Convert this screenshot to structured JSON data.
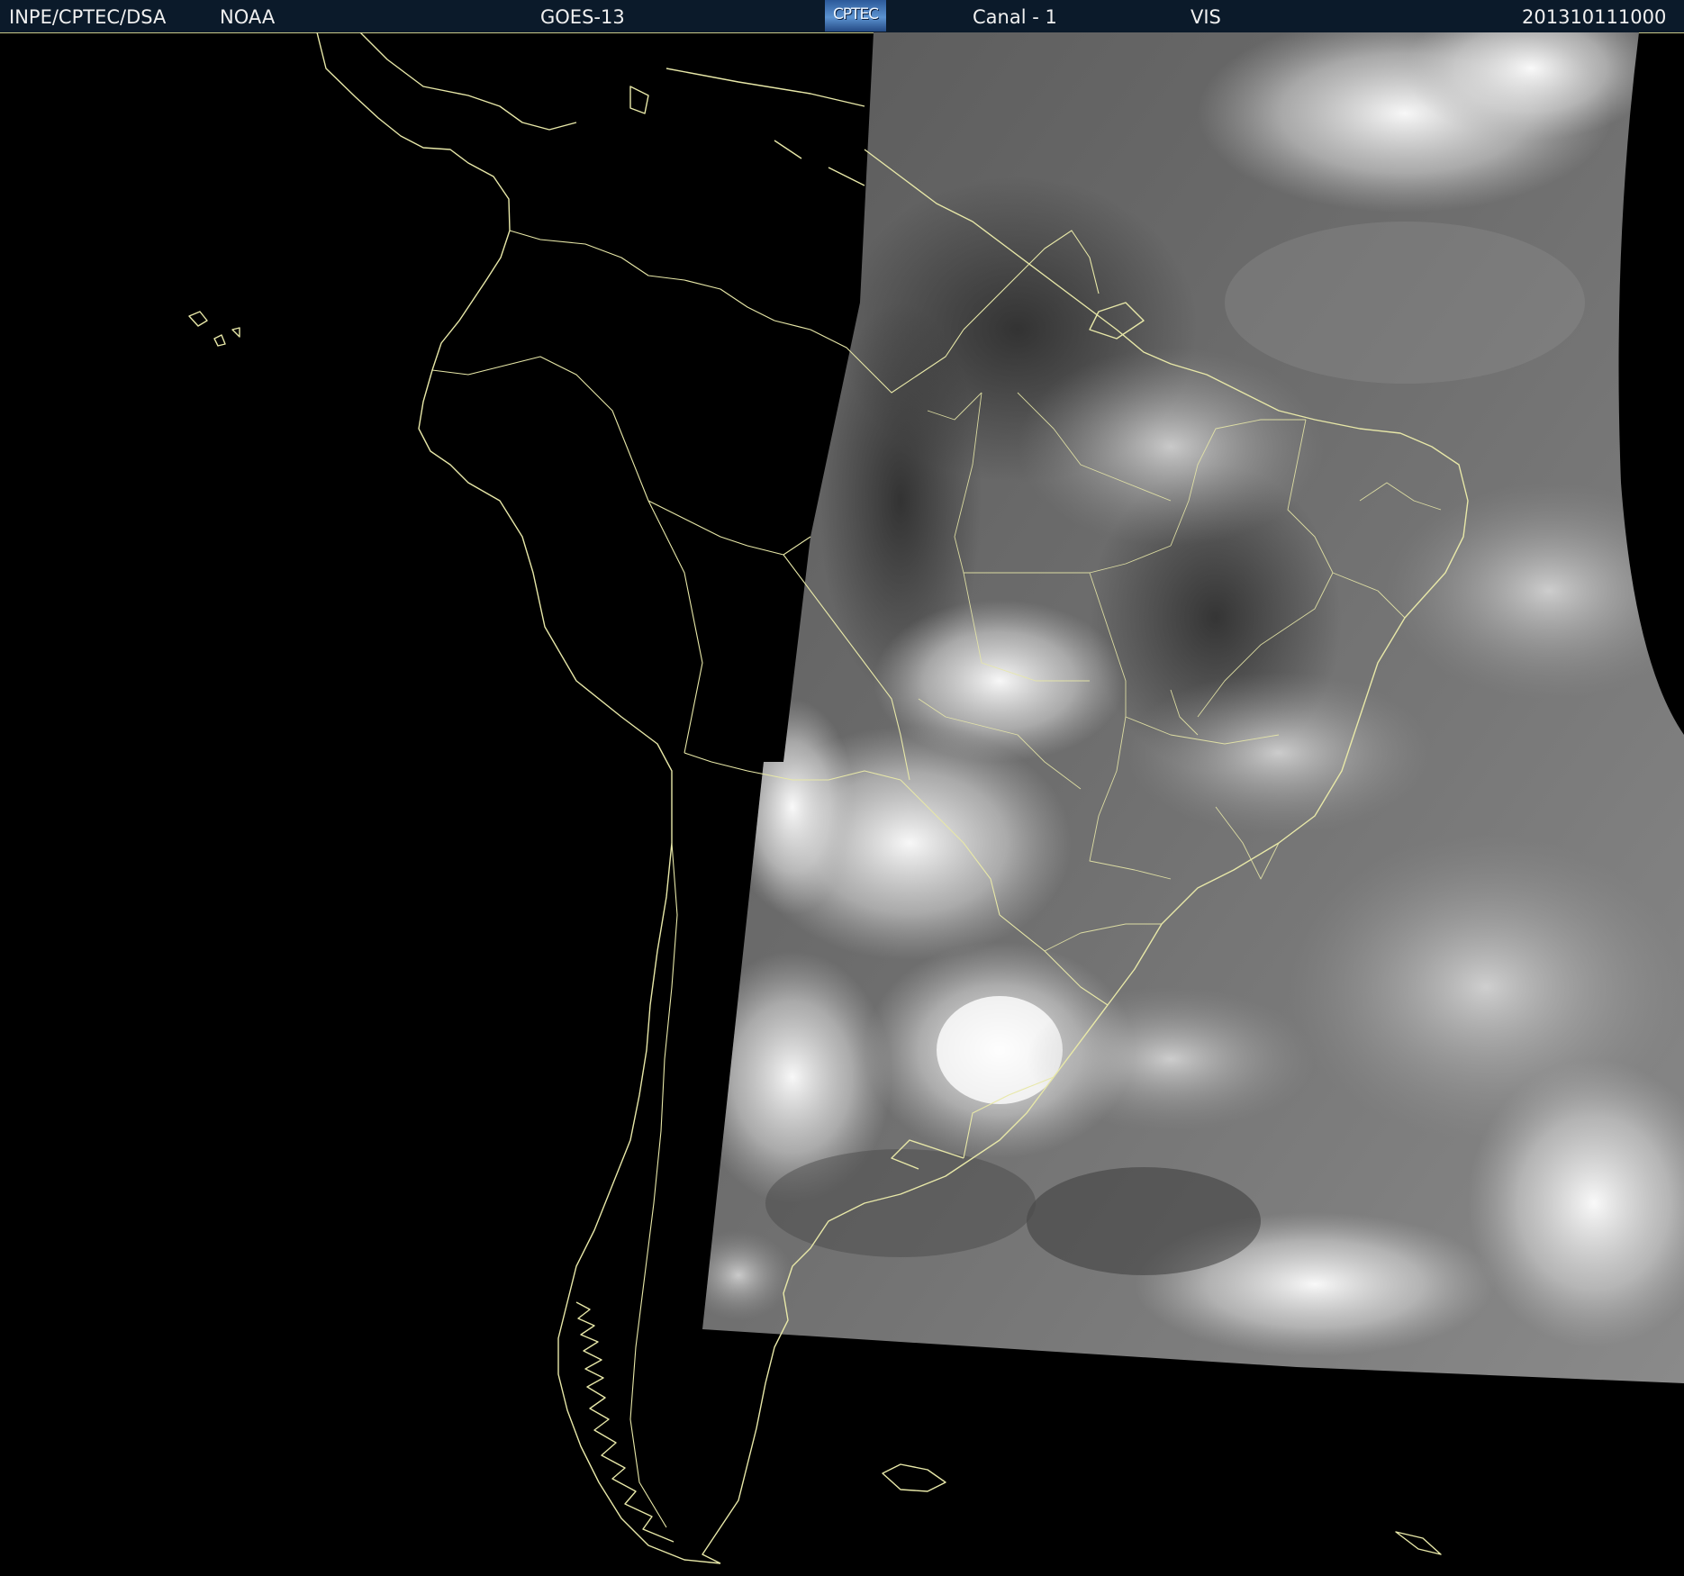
{
  "header": {
    "institution": "INPE/CPTEC/DSA",
    "agency": "NOAA",
    "satellite": "GOES-13",
    "logo_text": "CPTEC",
    "channel": "Canal - 1",
    "band": "VIS",
    "timestamp": "201310111000"
  },
  "map": {
    "background_color": "#000000",
    "coastline_color": "#e8e8a8",
    "imagery": "visible-channel-grayscale"
  }
}
